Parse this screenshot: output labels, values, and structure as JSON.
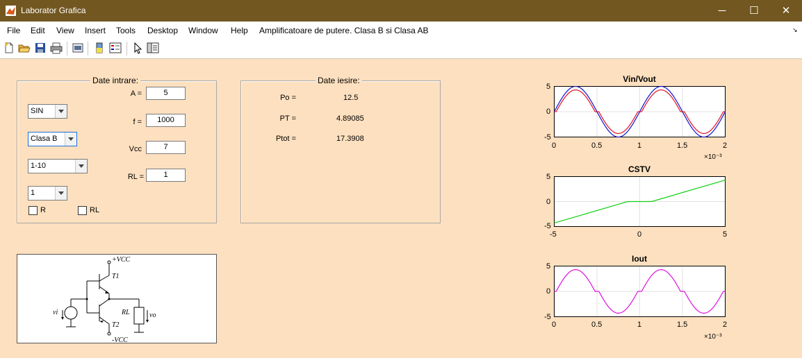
{
  "window": {
    "title": "Laborator Grafica",
    "minimize": "─",
    "maximize": "☐",
    "close": "✕"
  },
  "menubar": {
    "items": [
      "File",
      "Edit",
      "View",
      "Insert",
      "Tools",
      "Desktop",
      "Window",
      "Help"
    ],
    "figure_name": "Amplificatoare de putere. Clasa B si Clasa AB"
  },
  "inputs": {
    "title": "Date intrare:",
    "A_label": "A =",
    "A_value": "5",
    "f_label": "f =",
    "f_value": "1000",
    "Vcc_label": "Vcc",
    "Vcc_value": "7",
    "RL_label": "RL =",
    "RL_value": "1",
    "signal_select": "SIN",
    "class_select": "Clasa B",
    "range_select": "1-10",
    "step_select": "1",
    "chk_R_label": "R",
    "chk_RL_label": "RL"
  },
  "outputs": {
    "title": "Date iesire:",
    "Po_label": "Po =",
    "Po_value": "12.5",
    "PT_label": "PT =",
    "PT_value": "4.89085",
    "Ptot_label": "Ptot =",
    "Ptot_value": "17.3908"
  },
  "circuit": {
    "vcc": "+VCC",
    "vee": "-VCC",
    "t1": "T1",
    "t2": "T2",
    "rl": "RL",
    "vi": "vi",
    "vo": "vo"
  },
  "colors": {
    "vin": "#1010d0",
    "vout": "#e01020",
    "cstv": "#10d010",
    "iout": "#e010e0"
  },
  "plots": {
    "p1": {
      "title": "Vin/Vout",
      "xticks": [
        "0",
        "0.5",
        "1",
        "1.5",
        "2"
      ],
      "yticks": [
        "5",
        "0",
        "-5"
      ],
      "exp": "×10⁻³"
    },
    "p2": {
      "title": "CSTV",
      "xticks": [
        "-5",
        "0",
        "5"
      ],
      "yticks": [
        "5",
        "0",
        "-5"
      ]
    },
    "p3": {
      "title": "Iout",
      "xticks": [
        "0",
        "0.5",
        "1",
        "1.5",
        "2"
      ],
      "yticks": [
        "5",
        "0",
        "-5"
      ],
      "exp": "×10⁻³"
    }
  },
  "chart_data": [
    {
      "type": "line",
      "title": "Vin/Vout",
      "xlim": [
        0,
        0.002
      ],
      "ylim": [
        -5,
        5
      ],
      "grid": true,
      "series": [
        {
          "function": "vin = 5*sin(2*pi*1000*t)"
        },
        {
          "function": "vout = sign(vin)*max(|vin|-0.7,0)"
        }
      ]
    },
    {
      "type": "line",
      "title": "CSTV",
      "xlim": [
        -5,
        5
      ],
      "ylim": [
        -5,
        5
      ],
      "grid": true,
      "series": [
        {
          "x": [
            -5,
            -0.7,
            0.7,
            5
          ],
          "y": [
            -4.3,
            0,
            0,
            4.3
          ]
        }
      ]
    },
    {
      "type": "line",
      "title": "Iout",
      "xlim": [
        0,
        0.002
      ],
      "ylim": [
        -5,
        5
      ],
      "grid": true,
      "series": [
        {
          "function": "iout = vout/RL"
        }
      ]
    }
  ]
}
